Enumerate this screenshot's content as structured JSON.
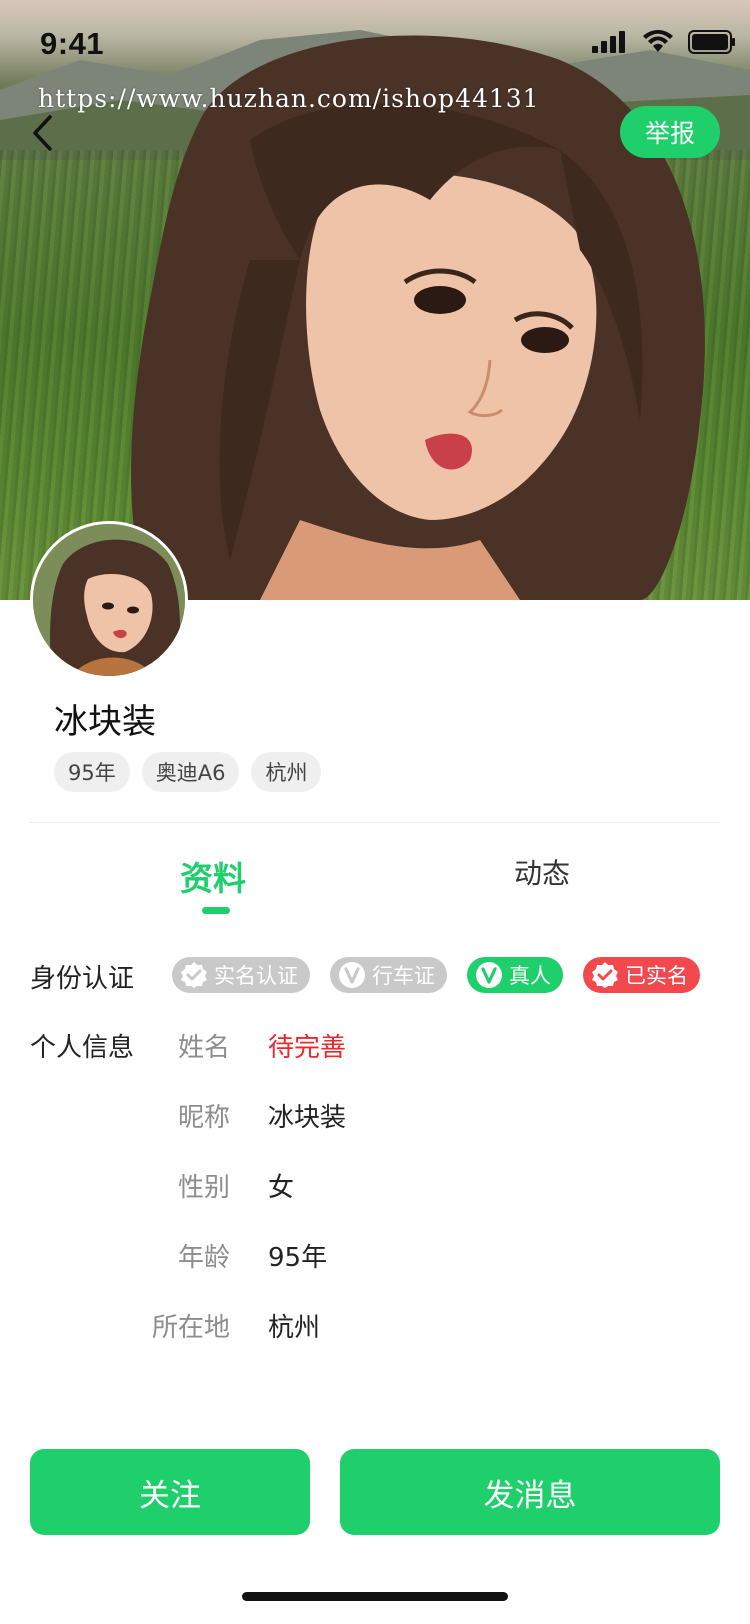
{
  "status_bar": {
    "time": "9:41"
  },
  "watermark": "https://www.huzhan.com/ishop44131",
  "header": {
    "back_icon": "chevron-left-icon",
    "report_label": "举报"
  },
  "profile": {
    "name": "冰块装",
    "tags": [
      "95年",
      "奥迪A6",
      "杭州"
    ]
  },
  "tabs": [
    {
      "label": "资料",
      "active": true
    },
    {
      "label": "动态",
      "active": false
    }
  ],
  "identity": {
    "label": "身份认证",
    "badges": [
      {
        "label": "实名认证",
        "icon": "verified-shield-icon",
        "state": "inactive"
      },
      {
        "label": "行车证",
        "icon": "v-badge-icon",
        "state": "inactive"
      },
      {
        "label": "真人",
        "icon": "v-badge-icon",
        "state": "active"
      },
      {
        "label": "已实名",
        "icon": "verified-shield-icon",
        "state": "verified"
      }
    ]
  },
  "personal_info": {
    "label": "个人信息",
    "fields": [
      {
        "label": "姓名",
        "value": "待完善",
        "pending": true
      },
      {
        "label": "昵称",
        "value": "冰块装"
      },
      {
        "label": "性别",
        "value": "女"
      },
      {
        "label": "年龄",
        "value": "95年"
      },
      {
        "label": "所在地",
        "value": "杭州"
      }
    ]
  },
  "actions": {
    "follow_label": "关注",
    "message_label": "发消息"
  },
  "colors": {
    "accent": "#1fcf6c",
    "pending": "#f0262b",
    "verified": "#f2494e",
    "inactive": "#c9c9c9"
  }
}
